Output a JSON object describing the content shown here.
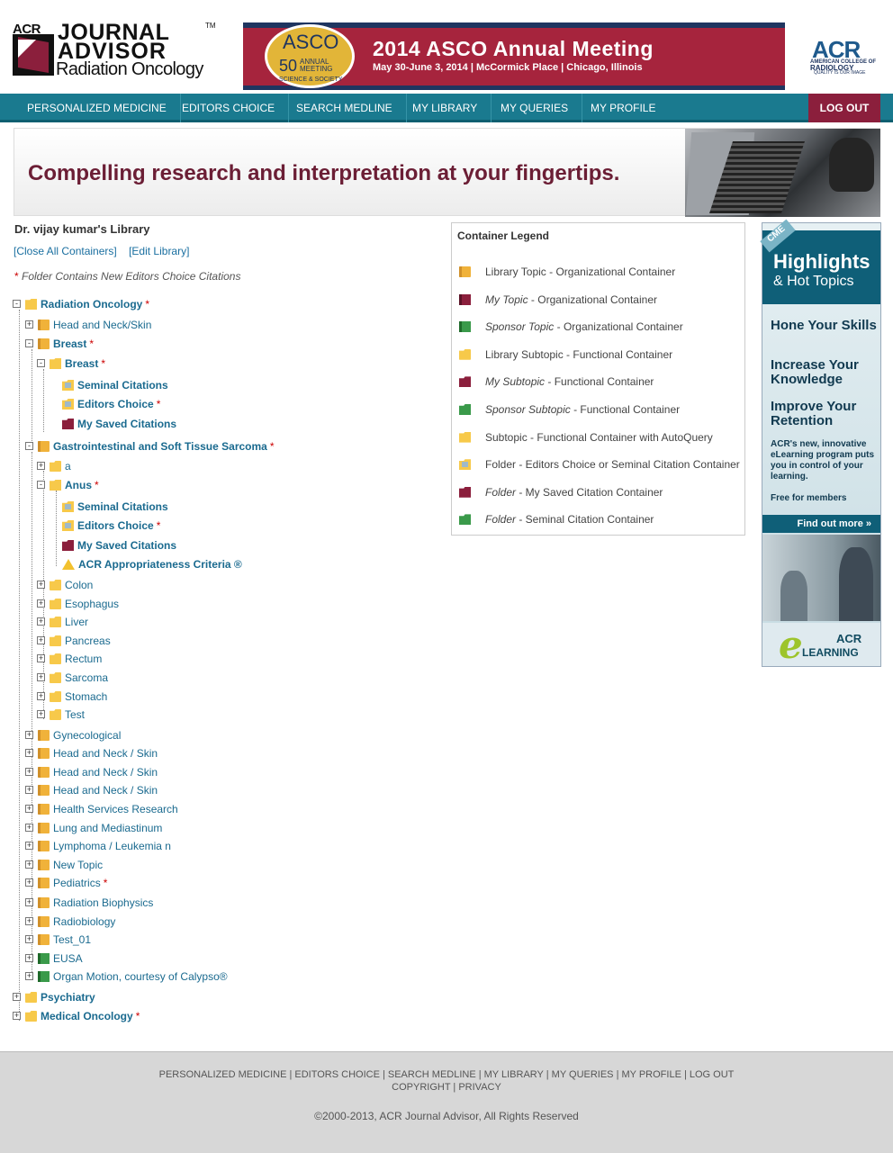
{
  "header": {
    "logo_acr": "ACR",
    "logo_tm": "TM",
    "logo_journal": "JOURNAL",
    "logo_advisor": "ADVISOR",
    "logo_sub": "Radiation Oncology",
    "asco_word": "ASCO",
    "asco_50": "50",
    "asco_annual": "ANNUAL MEETING",
    "asco_science": "SCIENCE & SOCIETY",
    "asco_title": "2014 ASCO Annual Meeting",
    "asco_details": "May 30-June 3, 2014  |  McCormick Place  |  Chicago, Illinois",
    "acr_big": "ACR",
    "acr_line1": "AMERICAN COLLEGE OF",
    "acr_line2": "RADIOLOGY",
    "acr_line3": "QUALITY IS OUR IMAGE"
  },
  "nav": {
    "items": [
      "PERSONALIZED MEDICINE",
      "EDITORS CHOICE",
      "SEARCH MEDLINE",
      "MY LIBRARY",
      "MY QUERIES",
      "MY PROFILE"
    ],
    "logout": "LOG OUT"
  },
  "banner": {
    "text": "Compelling research and interpretation at your fingertips."
  },
  "library": {
    "title": "Dr. vijay kumar's Library",
    "close_all": "[Close All Containers]",
    "edit": "[Edit Library]",
    "note_star": "*",
    "note": "Folder Contains New Editors Choice Citations"
  },
  "tree": [
    {
      "label": "Radiation Oncology",
      "star": "*"
    },
    {
      "label": "Head and Neck/Skin"
    },
    {
      "label": "Breast",
      "star": "*"
    },
    {
      "label": "Breast",
      "star": "*"
    },
    {
      "label": "Seminal Citations"
    },
    {
      "label": "Editors Choice",
      "star": "*"
    },
    {
      "label": "My Saved Citations"
    },
    {
      "label": "Gastrointestinal and Soft Tissue Sarcoma",
      "star": "*"
    },
    {
      "label": "a"
    },
    {
      "label": "Anus",
      "star": "*"
    },
    {
      "label": "Seminal Citations"
    },
    {
      "label": "Editors Choice",
      "star": "*"
    },
    {
      "label": "My Saved Citations"
    },
    {
      "label": "ACR Appropriateness Criteria ®"
    },
    {
      "label": "Colon"
    },
    {
      "label": "Esophagus"
    },
    {
      "label": "Liver"
    },
    {
      "label": "Pancreas"
    },
    {
      "label": "Rectum"
    },
    {
      "label": "Sarcoma"
    },
    {
      "label": "Stomach"
    },
    {
      "label": "Test"
    },
    {
      "label": "Gynecological"
    },
    {
      "label": "Head and Neck / Skin"
    },
    {
      "label": "Head and Neck / Skin"
    },
    {
      "label": "Head and Neck / Skin"
    },
    {
      "label": "Health Services Research"
    },
    {
      "label": "Lung and Mediastinum"
    },
    {
      "label": "Lymphoma / Leukemia n"
    },
    {
      "label": "New Topic"
    },
    {
      "label": "Pediatrics",
      "star": "*"
    },
    {
      "label": "Radiation Biophysics"
    },
    {
      "label": "Radiobiology"
    },
    {
      "label": "Test_01"
    },
    {
      "label": "EUSA"
    },
    {
      "label": "Organ Motion, courtesy of Calypso®"
    },
    {
      "label": "Psychiatry"
    },
    {
      "label": "Medical Oncology",
      "star": "*"
    }
  ],
  "legend": {
    "title": "Container Legend",
    "rows": [
      {
        "em": "",
        "text": "Library Topic - Organizational Container"
      },
      {
        "em": "My Topic",
        "text": " - Organizational Container"
      },
      {
        "em": "Sponsor Topic",
        "text": " - Organizational Container"
      },
      {
        "em": "",
        "text": "Library Subtopic - Functional Container"
      },
      {
        "em": "My Subtopic",
        "text": " - Functional Container"
      },
      {
        "em": "Sponsor Subtopic",
        "text": " - Functional Container"
      },
      {
        "em": "",
        "text": "Subtopic - Functional Container with AutoQuery"
      },
      {
        "em": "",
        "text": "Folder - Editors Choice or Seminal Citation Container"
      },
      {
        "em": "Folder",
        "text": " - My Saved Citation Container"
      },
      {
        "em": "Folder",
        "text": " - Seminal Citation Container"
      }
    ]
  },
  "ad": {
    "cme": "CME",
    "highlights": "Highlights",
    "hot": "& Hot Topics",
    "s1": "Hone Your Skills",
    "s2": "Increase Your Knowledge",
    "s3": "Improve Your Retention",
    "p": "ACR's new, innovative eLearning program puts you in control of your learning.",
    "free": "Free for members",
    "find": "Find out more »",
    "e": "e",
    "acr": "ACR",
    "learning": "LEARNING"
  },
  "footer": {
    "links1": "PERSONALIZED MEDICINE | EDITORS CHOICE | SEARCH MEDLINE | MY LIBRARY | MY QUERIES | MY PROFILE | LOG OUT",
    "links2": "COPYRIGHT | PRIVACY",
    "copyright": "©2000-2013, ACR Journal Advisor, All Rights Reserved"
  }
}
